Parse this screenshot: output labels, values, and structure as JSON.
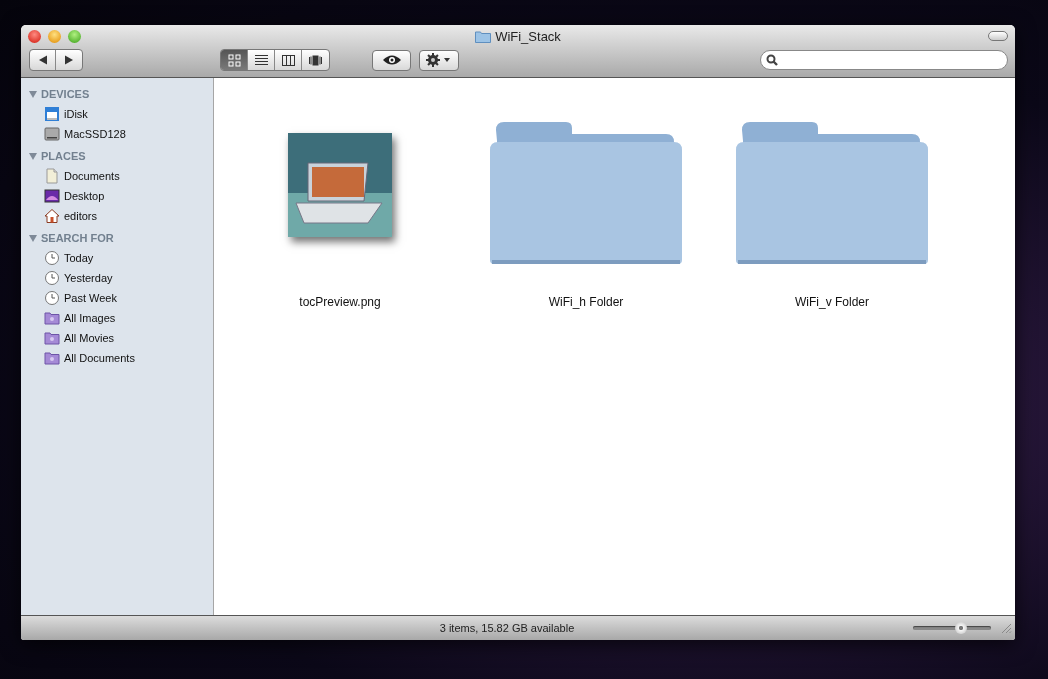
{
  "window": {
    "title": "WiFi_Stack"
  },
  "toolbar": {
    "view_buttons": [
      {
        "kind": "icon",
        "selected": true
      },
      {
        "kind": "list",
        "selected": false
      },
      {
        "kind": "columns",
        "selected": false
      },
      {
        "kind": "coverflow",
        "selected": false
      }
    ]
  },
  "sidebar": {
    "sections": [
      {
        "title": "DEVICES",
        "expanded": true,
        "items": [
          {
            "label": "iDisk",
            "kind": "idisk"
          },
          {
            "label": "MacSSD128",
            "kind": "drive"
          }
        ]
      },
      {
        "title": "PLACES",
        "expanded": true,
        "items": [
          {
            "label": "Documents",
            "kind": "documents"
          },
          {
            "label": "Desktop",
            "kind": "desktop"
          },
          {
            "label": "editors",
            "kind": "home"
          }
        ]
      },
      {
        "title": "SEARCH FOR",
        "expanded": true,
        "items": [
          {
            "label": "Today",
            "kind": "clock"
          },
          {
            "label": "Yesterday",
            "kind": "clock"
          },
          {
            "label": "Past Week",
            "kind": "clock"
          },
          {
            "label": "All Images",
            "kind": "smart-folder"
          },
          {
            "label": "All Movies",
            "kind": "smart-folder"
          },
          {
            "label": "All Documents",
            "kind": "smart-folder"
          }
        ]
      }
    ]
  },
  "files": [
    {
      "name": "tocPreview.png",
      "kind": "image"
    },
    {
      "name": "WiFi_h Folder",
      "kind": "folder"
    },
    {
      "name": "WiFi_v Folder",
      "kind": "folder"
    }
  ],
  "status_bar": {
    "text": "3 items, 15.82 GB available",
    "icon_size": {
      "level": 0.62
    }
  }
}
